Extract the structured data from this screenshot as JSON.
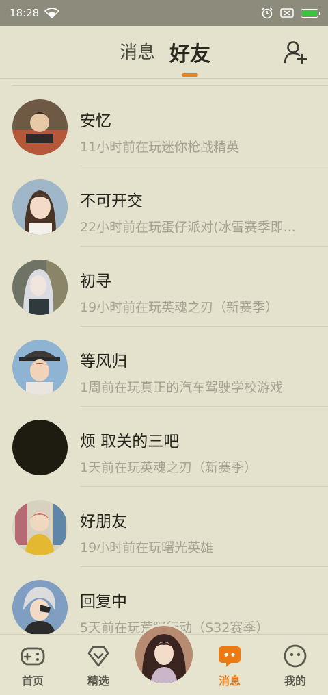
{
  "status": {
    "time": "18:28",
    "battery_level": 1.0
  },
  "header": {
    "tab_messages": "消息",
    "tab_friends": "好友",
    "active_tab": "好友",
    "accent": "#e8821e"
  },
  "friends": [
    {
      "name": "安忆",
      "activity": "11小时前在玩迷你枪战精英"
    },
    {
      "name": "不可开交",
      "activity": "22小时前在玩蛋仔派对(冰雪赛季即..."
    },
    {
      "name": "初寻",
      "activity": "19小时前在玩英魂之刃（新赛季）"
    },
    {
      "name": "等风归",
      "activity": "1周前在玩真正的汽车驾驶学校游戏"
    },
    {
      "name": "烦 取关的三吧",
      "activity": "1天前在玩英魂之刃（新赛季）"
    },
    {
      "name": "好朋友",
      "activity": "19小时前在玩曙光英雄"
    },
    {
      "name": "回复中",
      "activity": "5天前在玩荒野行动（S32赛季）"
    }
  ],
  "nav": {
    "home": "首页",
    "featured": "精选",
    "messages": "消息",
    "mine": "我的",
    "active": "消息"
  }
}
